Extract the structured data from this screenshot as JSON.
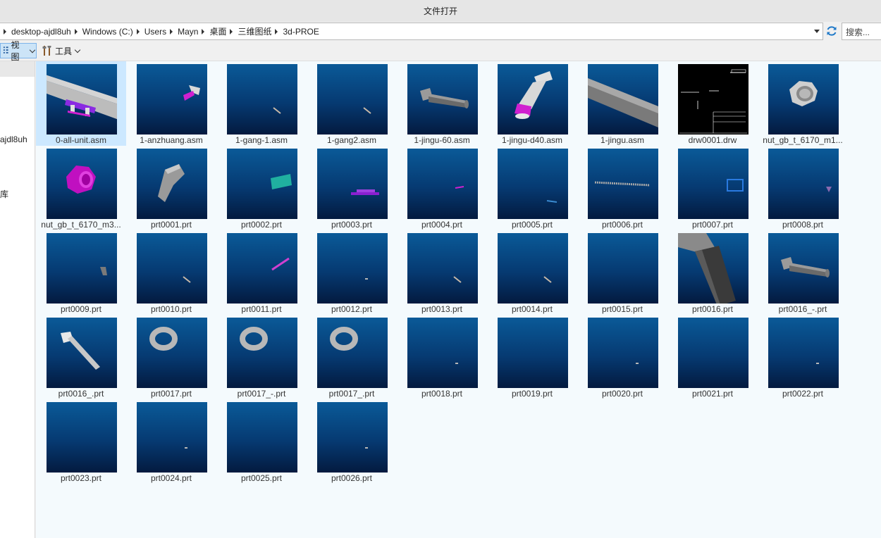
{
  "window": {
    "title": "文件打开"
  },
  "address": {
    "crumbs": [
      "desktop-ajdl8uh",
      "Windows (C:)",
      "Users",
      "Mayn",
      "桌面",
      "三维图纸",
      "3d-PROE"
    ],
    "search_placeholder": "搜索..."
  },
  "toolbar": {
    "view_label": "视图",
    "tools_label": "工具"
  },
  "sidebar": {
    "items": [
      "ajdl8uh",
      "库"
    ]
  },
  "colors": {
    "thumb_top": "#0a5a98",
    "thumb_bottom": "#031a3f",
    "selection": "#cce8ff",
    "accent": "#1e78c8"
  },
  "files": [
    {
      "name": "0-all-unit.asm",
      "icon": "assembly-all-unit-icon",
      "selected": true
    },
    {
      "name": "1-anzhuang.asm",
      "icon": "anzhuang-part-icon"
    },
    {
      "name": "1-gang-1.asm",
      "icon": "small-rod-icon"
    },
    {
      "name": "1-gang2.asm",
      "icon": "small-rod-icon"
    },
    {
      "name": "1-jingu-60.asm",
      "icon": "bolt-icon"
    },
    {
      "name": "1-jingu-d40.asm",
      "icon": "bolt-magenta-icon"
    },
    {
      "name": "1-jingu.asm",
      "icon": "cylinder-icon"
    },
    {
      "name": "drw0001.drw",
      "icon": "drawing-icon"
    },
    {
      "name": "nut_gb_t_6170_m1...",
      "icon": "nut-gray-icon"
    },
    {
      "name": "nut_gb_t_6170_m3...",
      "icon": "nut-magenta-icon"
    },
    {
      "name": "prt0001.prt",
      "icon": "bent-part-icon"
    },
    {
      "name": "prt0002.prt",
      "icon": "teal-plate-icon"
    },
    {
      "name": "prt0003.prt",
      "icon": "purple-bracket-icon"
    },
    {
      "name": "prt0004.prt",
      "icon": "small-magenta-icon"
    },
    {
      "name": "prt0005.prt",
      "icon": "small-blue-icon"
    },
    {
      "name": "prt0006.prt",
      "icon": "threaded-rod-icon"
    },
    {
      "name": "prt0007.prt",
      "icon": "blue-frame-icon"
    },
    {
      "name": "prt0008.prt",
      "icon": "small-purple-icon"
    },
    {
      "name": "prt0009.prt",
      "icon": "small-gray-icon"
    },
    {
      "name": "prt0010.prt",
      "icon": "small-rod-icon"
    },
    {
      "name": "prt0011.prt",
      "icon": "magenta-rod-icon"
    },
    {
      "name": "prt0012.prt",
      "icon": "tiny-dot-icon"
    },
    {
      "name": "prt0013.prt",
      "icon": "small-rod-icon"
    },
    {
      "name": "prt0014.prt",
      "icon": "small-rod-icon"
    },
    {
      "name": "prt0015.prt",
      "icon": "empty-part-icon"
    },
    {
      "name": "prt0016.prt",
      "icon": "large-bolt-icon"
    },
    {
      "name": "prt0016_-.prt",
      "icon": "bolt-icon"
    },
    {
      "name": "prt0016_.prt",
      "icon": "bolt-diagonal-icon"
    },
    {
      "name": "prt0017.prt",
      "icon": "washer-icon"
    },
    {
      "name": "prt0017_-.prt",
      "icon": "washer-icon"
    },
    {
      "name": "prt0017_.prt",
      "icon": "washer-icon"
    },
    {
      "name": "prt0018.prt",
      "icon": "tiny-dot-icon"
    },
    {
      "name": "prt0019.prt",
      "icon": "empty-part-icon"
    },
    {
      "name": "prt0020.prt",
      "icon": "tiny-dot-icon"
    },
    {
      "name": "prt0021.prt",
      "icon": "empty-part-icon"
    },
    {
      "name": "prt0022.prt",
      "icon": "tiny-dot-icon"
    },
    {
      "name": "prt0023.prt",
      "icon": "empty-part-icon"
    },
    {
      "name": "prt0024.prt",
      "icon": "tiny-dot-icon"
    },
    {
      "name": "prt0025.prt",
      "icon": "empty-part-icon"
    },
    {
      "name": "prt0026.prt",
      "icon": "tiny-dot-icon"
    }
  ]
}
